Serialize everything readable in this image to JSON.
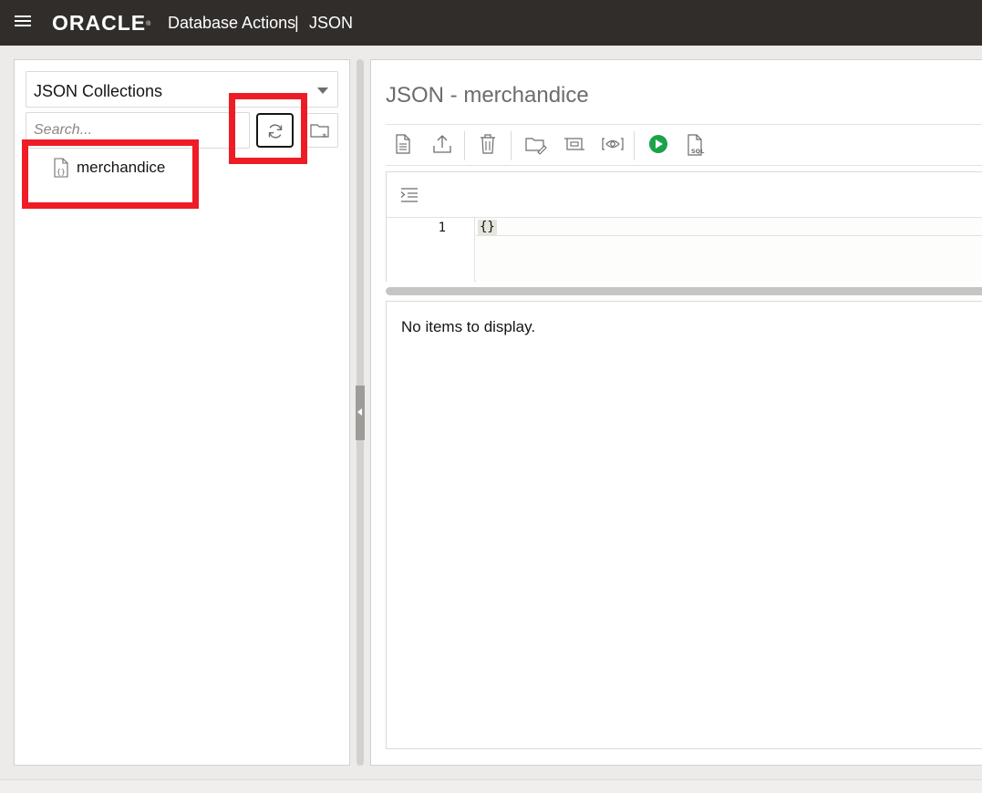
{
  "header": {
    "brand": "ORACLE",
    "product": "Database Actions",
    "separator": "|",
    "section": "JSON"
  },
  "sidebar": {
    "collection_type": "JSON Collections",
    "search_placeholder": "Search...",
    "items": [
      {
        "label": "merchandice",
        "icon": "json-document-icon"
      }
    ]
  },
  "main": {
    "title": "JSON - merchandice",
    "toolbar_icons": [
      "new-document-icon",
      "upload-icon",
      "delete-icon",
      "open-folder-icon",
      "select-region-icon",
      "view-icon",
      "run-icon",
      "sql-icon"
    ],
    "editor": {
      "line_number": "1",
      "content": "{}"
    },
    "results_message": "No items to display."
  },
  "colors": {
    "header_bg": "#312d2a",
    "run_green": "#1ca249",
    "highlight_red": "#ee1c25"
  }
}
